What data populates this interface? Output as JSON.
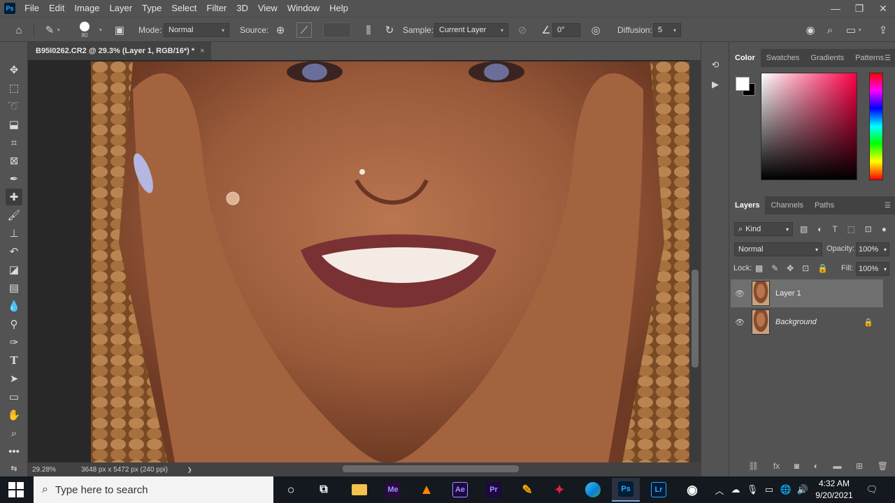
{
  "app": {
    "logo": "Ps"
  },
  "menu": [
    "File",
    "Edit",
    "Image",
    "Layer",
    "Type",
    "Select",
    "Filter",
    "3D",
    "View",
    "Window",
    "Help"
  ],
  "window_controls": {
    "minimize": "—",
    "restore": "❐",
    "close": "✕"
  },
  "options": {
    "brush_size": "80",
    "mode_label": "Mode:",
    "mode_value": "Normal",
    "source_label": "Source:",
    "sample_label": "Sample:",
    "sample_value": "Current Layer",
    "angle_value": "0°",
    "diffusion_label": "Diffusion:",
    "diffusion_value": "5"
  },
  "document": {
    "tab_title": "B95I0262.CR2 @ 29.3% (Layer 1, RGB/16*) *",
    "tab_close": "×",
    "zoom": "29.28%",
    "dimensions": "3648 px x 5472 px (240 ppi)",
    "status_arrow": "❯"
  },
  "color_panel": {
    "tabs": [
      "Color",
      "Swatches",
      "Gradients",
      "Patterns"
    ],
    "foreground": "#ffffff",
    "background": "#000000"
  },
  "layers_panel": {
    "tabs": [
      "Layers",
      "Channels",
      "Paths"
    ],
    "filter_kind": "Kind",
    "blend_mode": "Normal",
    "opacity_label": "Opacity:",
    "opacity_value": "100%",
    "lock_label": "Lock:",
    "fill_label": "Fill:",
    "fill_value": "100%",
    "layers": [
      {
        "name": "Layer 1",
        "selected": true
      },
      {
        "name": "Background",
        "selected": false,
        "locked": true
      }
    ]
  },
  "taskbar": {
    "search_placeholder": "Type here to search",
    "time": "4:32 AM",
    "date": "9/20/2021",
    "apps": [
      {
        "icon": "cortana-icon"
      },
      {
        "icon": "task-view-icon"
      },
      {
        "icon": "file-explorer-icon"
      },
      {
        "label": "Me",
        "color": "#2b0a3d",
        "text_color": "#9999ff"
      },
      {
        "icon": "vlc-icon"
      },
      {
        "label": "Ae",
        "color": "#1f0740",
        "text_color": "#9999ff"
      },
      {
        "label": "Pr",
        "color": "#1f0740",
        "text_color": "#9999ff"
      },
      {
        "icon": "fl-studio-icon"
      },
      {
        "icon": "game-icon"
      },
      {
        "icon": "edge-icon"
      },
      {
        "label": "Ps",
        "color": "#001e36",
        "text_color": "#31a8ff",
        "active": true
      },
      {
        "label": "Lr",
        "color": "#001a36",
        "text_color": "#31a8ff"
      },
      {
        "icon": "obs-icon"
      }
    ]
  }
}
